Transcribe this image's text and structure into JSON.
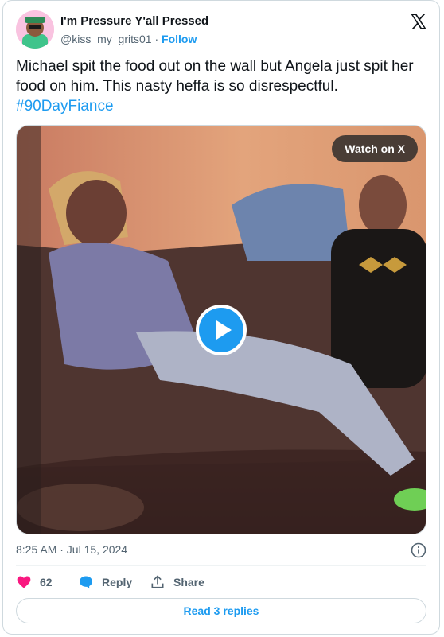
{
  "author": {
    "display_name": "I'm Pressure Y'all Pressed",
    "handle": "@kiss_my_grits01",
    "separator": "·",
    "follow_label": "Follow"
  },
  "tweet": {
    "text": "Michael spit the food out on the wall but Angela just spit her food on him. This nasty heffa is so disrespectful.",
    "hashtag": "#90DayFiance",
    "timestamp": "8:25 AM · Jul 15, 2024"
  },
  "media": {
    "watch_label": "Watch on X"
  },
  "actions": {
    "like_count": "62",
    "reply_label": "Reply",
    "share_label": "Share"
  },
  "read_replies_label": "Read 3 replies",
  "colors": {
    "accent": "#1d9bf0",
    "like": "#f91880",
    "secondary_text": "#536471",
    "border": "#cfd9de"
  },
  "icons": [
    "x-logo-icon",
    "play-icon",
    "info-icon",
    "heart-icon",
    "reply-bubble-icon",
    "share-icon"
  ]
}
